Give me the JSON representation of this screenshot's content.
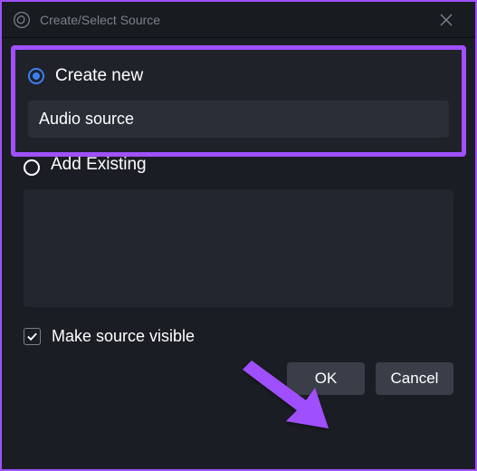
{
  "titlebar": {
    "title": "Create/Select Source"
  },
  "options": {
    "create_new_label": "Create new",
    "add_existing_label": "Add Existing"
  },
  "input": {
    "value": "Audio source"
  },
  "checkbox": {
    "visible_label": "Make source visible"
  },
  "buttons": {
    "ok": "OK",
    "cancel": "Cancel"
  }
}
